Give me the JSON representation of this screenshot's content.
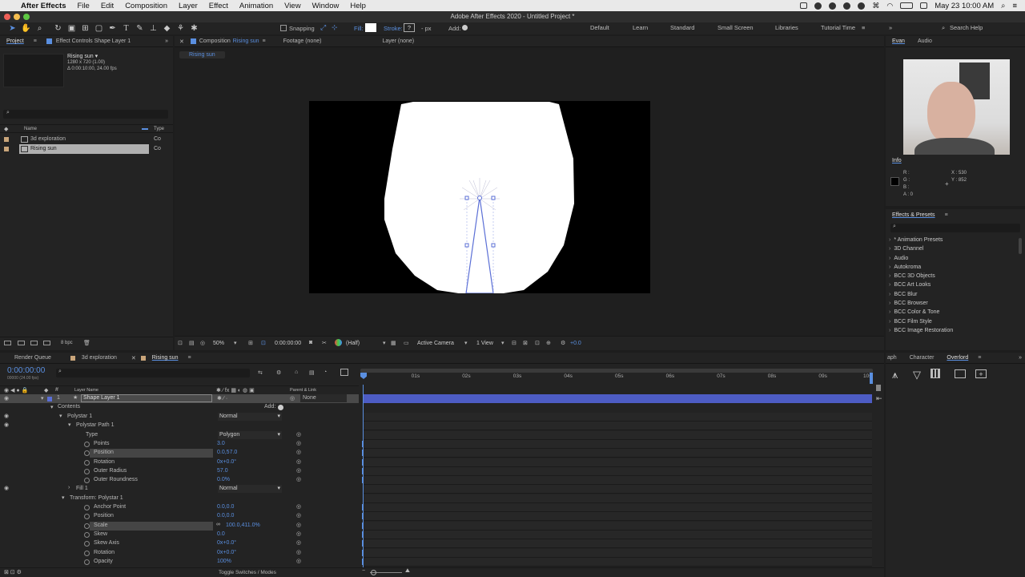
{
  "menubar": {
    "app_name": "After Effects",
    "menus": [
      "File",
      "Edit",
      "Composition",
      "Layer",
      "Effect",
      "Animation",
      "View",
      "Window",
      "Help"
    ],
    "clock": "May 23  10:00 AM"
  },
  "titlebar": {
    "title": "Adobe After Effects 2020 - Untitled Project *"
  },
  "toolbar": {
    "snapping": "Snapping",
    "fill": "Fill:",
    "stroke": "Stroke:",
    "stroke_value": "?",
    "px": "- px",
    "add": "Add:",
    "workspaces": [
      "Default",
      "Learn",
      "Standard",
      "Small Screen",
      "Libraries",
      "Tutorial Time"
    ],
    "search_placeholder": "Search Help"
  },
  "project_panel": {
    "tab_project": "Project",
    "tab_effect_controls": "Effect Controls Shape Layer 1",
    "comp_name": "Rising sun ▾",
    "comp_size": "1280 x 720 (1.00)",
    "comp_duration": "Δ 0:00:10:00, 24.00 fps",
    "col_name": "Name",
    "col_type": "Type",
    "items": [
      {
        "name": "3d exploration",
        "type": "Co"
      },
      {
        "name": "Rising sun",
        "type": "Co"
      }
    ],
    "bpc": "8 bpc"
  },
  "comp_panel": {
    "tab_composition": "Composition",
    "tab_composition_name": "Rising sun",
    "tab_footage": "Footage (none)",
    "tab_layer": "Layer (none)",
    "breadcrumb": "Rising sun",
    "zoom": "50%",
    "timecode": "0:00:00:00",
    "resolution": "(Half)",
    "camera": "Active Camera",
    "view": "1 View",
    "exposure": "+0.0"
  },
  "right_top": {
    "tab_evan": "Evan",
    "tab_audio": "Audio"
  },
  "info_panel": {
    "title": "Info",
    "r": "R :",
    "g": "G :",
    "b": "B :",
    "a": "A : 0",
    "x": "X : 530",
    "y": "Y : 852"
  },
  "effects_panel": {
    "title": "Effects & Presets",
    "items": [
      "* Animation Presets",
      "3D Channel",
      "Audio",
      "Autokroma",
      "BCC 3D Objects",
      "BCC Art Looks",
      "BCC Blur",
      "BCC Browser",
      "BCC Color & Tone",
      "BCC Film Style",
      "BCC Image Restoration"
    ]
  },
  "bottom_right": {
    "tab_graph": "aph",
    "tab_character": "Character",
    "tab_overlord": "Overlord"
  },
  "timeline": {
    "tabs": [
      "Render Queue",
      "3d exploration",
      "Rising sun"
    ],
    "timecode": "0:00:00:00",
    "timecode_sub": "00000 (24.00 fps)",
    "col_layer_name": "Layer Name",
    "col_parent": "Parent & Link",
    "layer_num": "1",
    "layer_name": "Shape Layer 1",
    "parent": "None",
    "contents": "Contents",
    "add": "Add:",
    "ruler": [
      "0s",
      "01s",
      "02s",
      "03s",
      "04s",
      "05s",
      "06s",
      "07s",
      "08s",
      "09s",
      "10s"
    ],
    "footer": "Toggle Switches / Modes",
    "properties": [
      {
        "name": "Polystar 1",
        "value": "Normal"
      },
      {
        "name": "Polystar Path 1",
        "value": ""
      },
      {
        "name": "Type",
        "value": "Polygon"
      },
      {
        "name": "Points",
        "value": "3.0"
      },
      {
        "name": "Position",
        "value": "0.0,57.0"
      },
      {
        "name": "Rotation",
        "value": "0x+0.0°"
      },
      {
        "name": "Outer Radius",
        "value": "57.0"
      },
      {
        "name": "Outer Roundness",
        "value": "0.0%"
      },
      {
        "name": "Fill 1",
        "value": "Normal"
      },
      {
        "name": "Transform: Polystar 1",
        "value": ""
      },
      {
        "name": "Anchor Point",
        "value": "0.0,0.0"
      },
      {
        "name": "Position",
        "value": "0.0,0.0"
      },
      {
        "name": "Scale",
        "value": "100.0,411.0%"
      },
      {
        "name": "Skew",
        "value": "0.0"
      },
      {
        "name": "Skew Axis",
        "value": "0x+0.0°"
      },
      {
        "name": "Rotation",
        "value": "0x+0.0°"
      },
      {
        "name": "Opacity",
        "value": "100%"
      }
    ]
  },
  "colors": {
    "accent": "#5a8fe0",
    "layer_bar": "#4d5cc4",
    "label": "#5b6fd6"
  }
}
